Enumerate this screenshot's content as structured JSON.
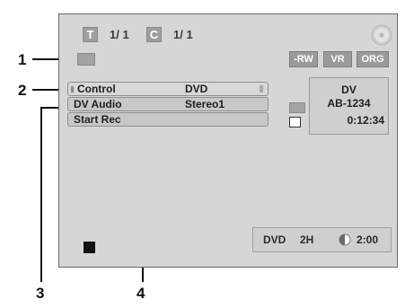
{
  "header": {
    "title_label": "T",
    "title_value": "1/ 1",
    "chapter_label": "C",
    "chapter_value": "1/ 1"
  },
  "format_tags": [
    "-RW",
    "VR",
    "ORG"
  ],
  "menu": {
    "rows": [
      {
        "label": "Control",
        "value": "DVD"
      },
      {
        "label": "DV Audio",
        "value": "Stereo1"
      },
      {
        "label": "Start Rec",
        "value": ""
      }
    ]
  },
  "dv_info": {
    "title": "DV",
    "device": "AB-1234",
    "timecode": "0:12:34"
  },
  "status": {
    "media": "DVD",
    "mode": "2H",
    "remaining": "2:00"
  },
  "callouts": {
    "c1": "1",
    "c2": "2",
    "c3": "3",
    "c4": "4"
  }
}
